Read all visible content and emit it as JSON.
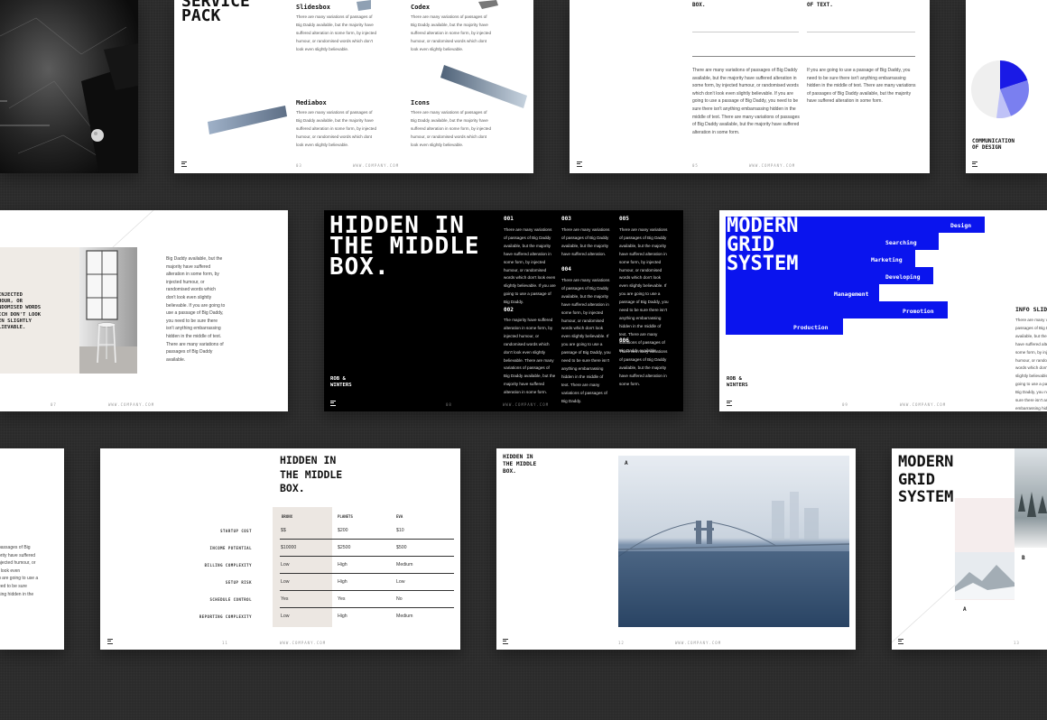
{
  "lorem_short": "There are many variations of passages of Big Daddy available, but the majority have suffered alteration in some form, by injected humour, or randomised words which don't look even slightly believable.",
  "footer_url": "WWW.COMPANY.COM",
  "brand": "ROB &\nWINTERS",
  "s1": {
    "title": "SERVICE\nPACK",
    "items": [
      {
        "title": "Slidesbox",
        "body": "There are many variations of passages of Big Daddy available, but the majority have suffered alteration in some form, by injected humour, or randomised words which don't look even slightly believable."
      },
      {
        "title": "Codex",
        "body": "There are many variations of passages of Big Daddy available, but the majority have suffered alteration in some form, by injected humour, or randomised words which dont look even slightly believable."
      },
      {
        "title": "Mediabox",
        "body": "There are many variations of passages of Big Daddy available, but the majority have suffered alteration in some form, by injected humour, or randomised words which dont look even slightly believable."
      },
      {
        "title": "Icons",
        "body": "There are many variations of passages of Big Daddy available, but the majority have suffered alteration in some form, by injected humour, or randomised words which dont look even slightly believable."
      }
    ],
    "page": "03"
  },
  "s2": {
    "head_a": "THE MIDDLE\nBOX.",
    "head_b": "IN THE MIDDLE\nOF TEXT.",
    "col_a": "There are many variations of passages of Big Daddy available, but the majority have suffered alteration in some form, by injected humour, or randomised words which don't look even slightly believable. If you are going to use a passage of Big Daddy, you need to be sure there isn't anything embarrassing hidden in the middle of text. There are many variations of passages of Big Daddy available, but the majority have suffered alteration in some form.",
    "col_b": "If you are going to use a passage of Big Daddy, you need to be sure there isn't anything embarrassing hidden in the middle of text. There are many variations of passages of Big Daddy available, but the majority have suffered alteration in some form.",
    "page": "05"
  },
  "s3": {
    "caption": "COMMUNICATION\nOF DESIGN"
  },
  "s4": {
    "quote": "INJECTED\nHOUR, OR\nNDOMISED WORDS\nICH DON'T LOOK\nEN SLIGHTLY\nLIEVABLE.",
    "body": "Big Daddy available, but the majority have suffered alteration in some form, by injected humour, or randomised words which don't look even slightly believable. If you are going to use a passage of Big Daddy, you need to be sure there isn't anything embarrassing hidden in the middle of text. There are many variations of passages of Big Daddy available.",
    "page": "07"
  },
  "s5": {
    "title": "HIDDEN IN\nTHE MIDDLE\nBOX.",
    "cols": [
      {
        "num": "001",
        "body": "There are many variations of passages of Big Daddy available, but the majority have suffered alteration in some form, by injected humour, or randomised words which don't look even slightly believable. If you are going to use a passage of Big Daddy."
      },
      {
        "num": "002",
        "body": "The majority have suffered alteration in some form, by injected humour, or randomised words which don't look even slightly believable. There are many variations of passages of Big Daddy available, but the majority have suffered alteration in some form."
      },
      {
        "num": "003",
        "body": "There are many variations of passages of Big Daddy available, but the majority have suffered alteration."
      },
      {
        "num": "004",
        "body": "There are many variations of passages of Big Daddy available, but the majority have suffered alteration in some form, by injected humour, or randomised words which don't look even slightly believable. If you are going to use a passage of Big Daddy, you need to be sure there isn't anything embarrassing hidden in the middle of text. There are many variations of passages of Big Daddy."
      },
      {
        "num": "005",
        "body": "There are many variations of passages of Big Daddy available, but the majority have suffered alteration in some form, by injected humour, or randomised words which don't look even slightly believable. If you are going to use a passage of Big Daddy, you need to be sure there isn't anything embarrassing hidden in the middle of text. There are many variations of passages of Big Daddy available."
      },
      {
        "num": "006",
        "body": "There are many variations of passages of Big Daddy available, but the majority have suffered alteration in some form."
      }
    ],
    "page": "08"
  },
  "s6": {
    "title": "MODERN\nGRID\nSYSTEM",
    "steps": [
      "Design",
      "Searching",
      "Marketing",
      "Developing",
      "Management",
      "Promotion",
      "Production"
    ],
    "side_title": "INFO SLID",
    "side_body": "There are many variations of passages of Big Daddy available, but the majority have suffered alteration in some form, by injected humour, or randomised words which don't look even slightly believable. If you are going to use a passage of Big Daddy, you need to be sure there isn't anything embarrassing hidden in the middle of text.",
    "page": "09"
  },
  "s7": {
    "body": "passages of Big\nority have suffered\nnjected humour, or\nt look even\nu are going to use a\need to be sure\nsing hidden in the"
  },
  "s8": {
    "title": "HIDDEN IN\nTHE MIDDLE\nBOX.",
    "cols": [
      "BRONX",
      "PLANETS",
      "EVA"
    ],
    "rows": [
      {
        "label": "STARTUP COST",
        "vals": [
          "$$",
          "$200",
          "$10"
        ]
      },
      {
        "label": "INCOME POTENTIAL",
        "vals": [
          "$10000",
          "$2500",
          "$500"
        ]
      },
      {
        "label": "BILLING COMPLEXITY",
        "vals": [
          "Low",
          "High",
          "Medium"
        ]
      },
      {
        "label": "SETUP RISK",
        "vals": [
          "Low",
          "High",
          "Low"
        ]
      },
      {
        "label": "SCHEDULE CONTROL",
        "vals": [
          "Yes",
          "Yes",
          "No"
        ]
      },
      {
        "label": "REPORTING COMPLEXITY",
        "vals": [
          "Low",
          "High",
          "Medium"
        ]
      }
    ],
    "page": "11"
  },
  "s9": {
    "title": "HIDDEN IN\nTHE MIDDLE\nBOX.",
    "tag": "A",
    "page": "12"
  },
  "s10": {
    "title": "MODERN\nGRID\nSYSTEM.",
    "tag_b": "B",
    "tag_a": "A",
    "page": "13"
  }
}
